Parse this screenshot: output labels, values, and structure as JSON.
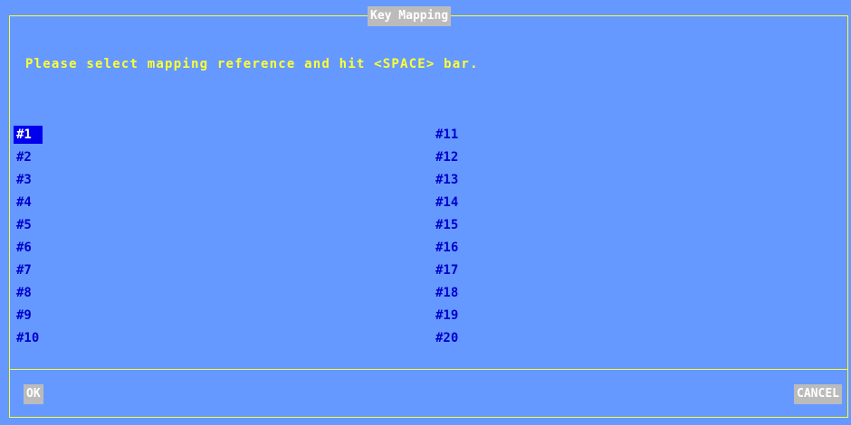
{
  "dialog": {
    "title": "Key Mapping",
    "prompt": "Please select mapping reference and hit <SPACE> bar."
  },
  "list": {
    "selected": "#1",
    "left_column": [
      "#1",
      "#2",
      "#3",
      "#4",
      "#5",
      "#6",
      "#7",
      "#8",
      "#9",
      "#10"
    ],
    "right_column": [
      "#11",
      "#12",
      "#13",
      "#14",
      "#15",
      "#16",
      "#17",
      "#18",
      "#19",
      "#20"
    ]
  },
  "buttons": {
    "ok_label": "OK",
    "cancel_label": "CANCEL"
  },
  "colors": {
    "background": "#6699ff",
    "border": "#ffff33",
    "prompt_text": "#ffff33",
    "item_text": "#0000cc",
    "selection_background": "#0000ee",
    "button_background": "#bbbbbb",
    "button_text": "#ffffff"
  }
}
